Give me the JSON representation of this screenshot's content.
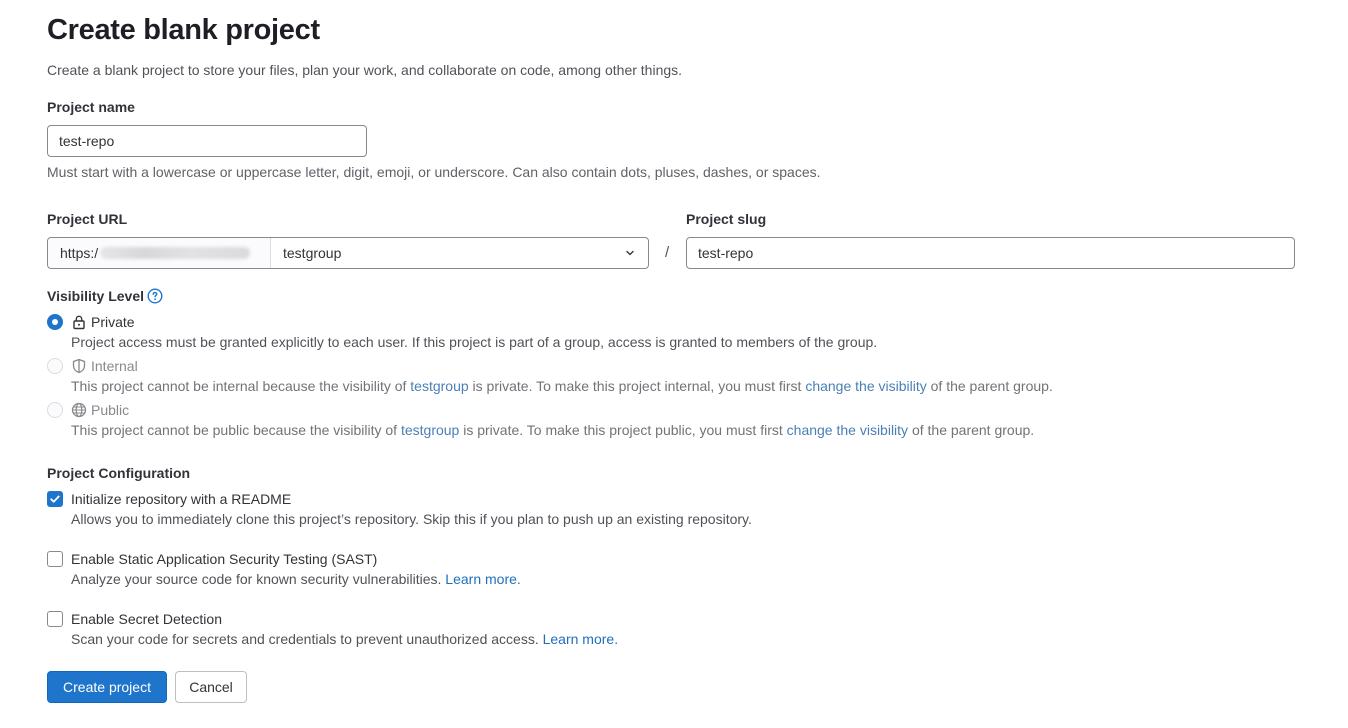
{
  "page": {
    "title": "Create blank project",
    "description": "Create a blank project to store your files, plan your work, and collaborate on code, among other things."
  },
  "project_name": {
    "label": "Project name",
    "value": "test-repo",
    "help": "Must start with a lowercase or uppercase letter, digit, emoji, or underscore. Can also contain dots, pluses, dashes, or spaces."
  },
  "project_url": {
    "label": "Project URL",
    "prefix": "https:/",
    "namespace": "testgroup",
    "separator": "/"
  },
  "project_slug": {
    "label": "Project slug",
    "value": "test-repo"
  },
  "visibility": {
    "label": "Visibility Level",
    "help_icon": "question-circle-icon",
    "options": [
      {
        "label": "Private",
        "icon": "lock-icon",
        "selected": true,
        "disabled": false,
        "description": "Project access must be granted explicitly to each user. If this project is part of a group, access is granted to members of the group."
      },
      {
        "label": "Internal",
        "icon": "shield-icon",
        "selected": false,
        "disabled": true,
        "desc_pre": "This project cannot be internal because the visibility of ",
        "desc_link1": "testgroup",
        "desc_mid": " is private. To make this project internal, you must first ",
        "desc_link2": "change the visibility",
        "desc_post": " of the parent group."
      },
      {
        "label": "Public",
        "icon": "globe-icon",
        "selected": false,
        "disabled": true,
        "desc_pre": "This project cannot be public because the visibility of ",
        "desc_link1": "testgroup",
        "desc_mid": " is private. To make this project public, you must first ",
        "desc_link2": "change the visibility",
        "desc_post": " of the parent group."
      }
    ]
  },
  "configuration": {
    "label": "Project Configuration",
    "options": [
      {
        "label": "Initialize repository with a README",
        "checked": true,
        "description": "Allows you to immediately clone this project’s repository. Skip this if you plan to push up an existing repository.",
        "link": ""
      },
      {
        "label": "Enable Static Application Security Testing (SAST)",
        "checked": false,
        "description": "Analyze your source code for known security vulnerabilities. ",
        "link": "Learn more."
      },
      {
        "label": "Enable Secret Detection",
        "checked": false,
        "description": "Scan your code for secrets and credentials to prevent unauthorized access. ",
        "link": "Learn more."
      }
    ]
  },
  "buttons": {
    "create": "Create project",
    "cancel": "Cancel"
  },
  "colors": {
    "primary": "#1f75cb",
    "link": "#1f6fbf",
    "text": "#333238"
  }
}
